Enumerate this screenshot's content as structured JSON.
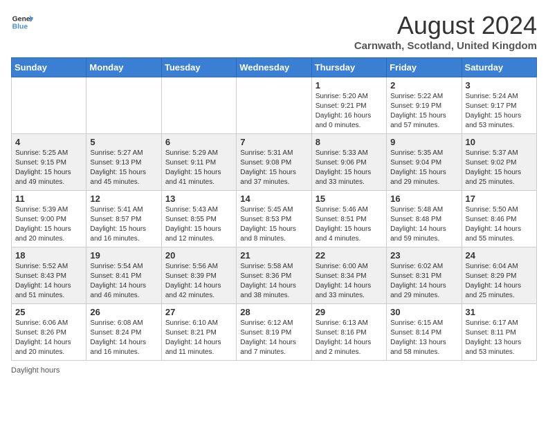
{
  "header": {
    "logo_line1": "General",
    "logo_line2": "Blue",
    "month_title": "August 2024",
    "location": "Carnwath, Scotland, United Kingdom"
  },
  "days_of_week": [
    "Sunday",
    "Monday",
    "Tuesday",
    "Wednesday",
    "Thursday",
    "Friday",
    "Saturday"
  ],
  "weeks": [
    [
      {
        "day": "",
        "info": ""
      },
      {
        "day": "",
        "info": ""
      },
      {
        "day": "",
        "info": ""
      },
      {
        "day": "",
        "info": ""
      },
      {
        "day": "1",
        "info": "Sunrise: 5:20 AM\nSunset: 9:21 PM\nDaylight: 16 hours\nand 0 minutes."
      },
      {
        "day": "2",
        "info": "Sunrise: 5:22 AM\nSunset: 9:19 PM\nDaylight: 15 hours\nand 57 minutes."
      },
      {
        "day": "3",
        "info": "Sunrise: 5:24 AM\nSunset: 9:17 PM\nDaylight: 15 hours\nand 53 minutes."
      }
    ],
    [
      {
        "day": "4",
        "info": "Sunrise: 5:25 AM\nSunset: 9:15 PM\nDaylight: 15 hours\nand 49 minutes."
      },
      {
        "day": "5",
        "info": "Sunrise: 5:27 AM\nSunset: 9:13 PM\nDaylight: 15 hours\nand 45 minutes."
      },
      {
        "day": "6",
        "info": "Sunrise: 5:29 AM\nSunset: 9:11 PM\nDaylight: 15 hours\nand 41 minutes."
      },
      {
        "day": "7",
        "info": "Sunrise: 5:31 AM\nSunset: 9:08 PM\nDaylight: 15 hours\nand 37 minutes."
      },
      {
        "day": "8",
        "info": "Sunrise: 5:33 AM\nSunset: 9:06 PM\nDaylight: 15 hours\nand 33 minutes."
      },
      {
        "day": "9",
        "info": "Sunrise: 5:35 AM\nSunset: 9:04 PM\nDaylight: 15 hours\nand 29 minutes."
      },
      {
        "day": "10",
        "info": "Sunrise: 5:37 AM\nSunset: 9:02 PM\nDaylight: 15 hours\nand 25 minutes."
      }
    ],
    [
      {
        "day": "11",
        "info": "Sunrise: 5:39 AM\nSunset: 9:00 PM\nDaylight: 15 hours\nand 20 minutes."
      },
      {
        "day": "12",
        "info": "Sunrise: 5:41 AM\nSunset: 8:57 PM\nDaylight: 15 hours\nand 16 minutes."
      },
      {
        "day": "13",
        "info": "Sunrise: 5:43 AM\nSunset: 8:55 PM\nDaylight: 15 hours\nand 12 minutes."
      },
      {
        "day": "14",
        "info": "Sunrise: 5:45 AM\nSunset: 8:53 PM\nDaylight: 15 hours\nand 8 minutes."
      },
      {
        "day": "15",
        "info": "Sunrise: 5:46 AM\nSunset: 8:51 PM\nDaylight: 15 hours\nand 4 minutes."
      },
      {
        "day": "16",
        "info": "Sunrise: 5:48 AM\nSunset: 8:48 PM\nDaylight: 14 hours\nand 59 minutes."
      },
      {
        "day": "17",
        "info": "Sunrise: 5:50 AM\nSunset: 8:46 PM\nDaylight: 14 hours\nand 55 minutes."
      }
    ],
    [
      {
        "day": "18",
        "info": "Sunrise: 5:52 AM\nSunset: 8:43 PM\nDaylight: 14 hours\nand 51 minutes."
      },
      {
        "day": "19",
        "info": "Sunrise: 5:54 AM\nSunset: 8:41 PM\nDaylight: 14 hours\nand 46 minutes."
      },
      {
        "day": "20",
        "info": "Sunrise: 5:56 AM\nSunset: 8:39 PM\nDaylight: 14 hours\nand 42 minutes."
      },
      {
        "day": "21",
        "info": "Sunrise: 5:58 AM\nSunset: 8:36 PM\nDaylight: 14 hours\nand 38 minutes."
      },
      {
        "day": "22",
        "info": "Sunrise: 6:00 AM\nSunset: 8:34 PM\nDaylight: 14 hours\nand 33 minutes."
      },
      {
        "day": "23",
        "info": "Sunrise: 6:02 AM\nSunset: 8:31 PM\nDaylight: 14 hours\nand 29 minutes."
      },
      {
        "day": "24",
        "info": "Sunrise: 6:04 AM\nSunset: 8:29 PM\nDaylight: 14 hours\nand 25 minutes."
      }
    ],
    [
      {
        "day": "25",
        "info": "Sunrise: 6:06 AM\nSunset: 8:26 PM\nDaylight: 14 hours\nand 20 minutes."
      },
      {
        "day": "26",
        "info": "Sunrise: 6:08 AM\nSunset: 8:24 PM\nDaylight: 14 hours\nand 16 minutes."
      },
      {
        "day": "27",
        "info": "Sunrise: 6:10 AM\nSunset: 8:21 PM\nDaylight: 14 hours\nand 11 minutes."
      },
      {
        "day": "28",
        "info": "Sunrise: 6:12 AM\nSunset: 8:19 PM\nDaylight: 14 hours\nand 7 minutes."
      },
      {
        "day": "29",
        "info": "Sunrise: 6:13 AM\nSunset: 8:16 PM\nDaylight: 14 hours\nand 2 minutes."
      },
      {
        "day": "30",
        "info": "Sunrise: 6:15 AM\nSunset: 8:14 PM\nDaylight: 13 hours\nand 58 minutes."
      },
      {
        "day": "31",
        "info": "Sunrise: 6:17 AM\nSunset: 8:11 PM\nDaylight: 13 hours\nand 53 minutes."
      }
    ]
  ],
  "footer": "Daylight hours"
}
